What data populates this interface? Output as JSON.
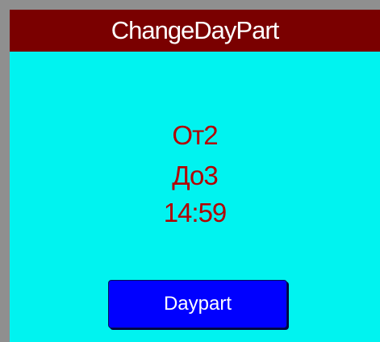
{
  "window": {
    "title": "ChangeDayPart"
  },
  "info": {
    "from_label": "От2",
    "to_label": "До3",
    "time": "14:59"
  },
  "actions": {
    "daypart_button_label": "Daypart"
  },
  "colors": {
    "outer_frame": "#8f8f8f",
    "background": "#00f3f0",
    "title_bar": "#7a0000",
    "title_text": "#ffffff",
    "info_text": "#b30000",
    "button": "#0000ff",
    "button_text": "#ffffff"
  }
}
